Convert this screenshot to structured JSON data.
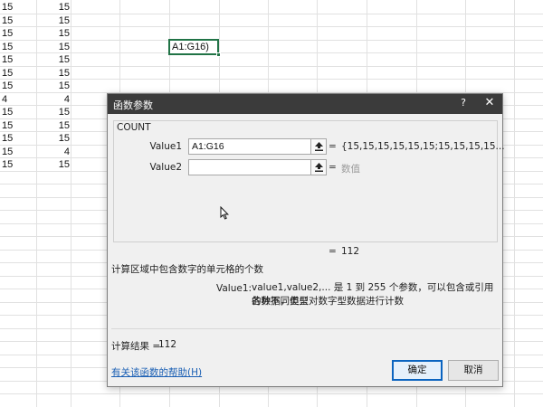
{
  "sheet": {
    "colA": [
      "15",
      "15",
      "15",
      "15",
      "15",
      "15",
      "15",
      "4",
      "15",
      "15",
      "15",
      "15",
      "15"
    ],
    "colB": [
      "15",
      "15",
      "15",
      "15",
      "15",
      "15",
      "15",
      "4",
      "15",
      "15",
      "15",
      "4",
      "15"
    ],
    "active_cell_text": "A1:G16)"
  },
  "dialog": {
    "title": "函数参数",
    "help_label": "?",
    "close_label": "✕",
    "function_name": "COUNT",
    "args": [
      {
        "label": "Value1",
        "value": "A1:G16",
        "placeholder": "",
        "equals": "=",
        "result": "{15,15,15,15,15,15;15,15,15,15..."
      },
      {
        "label": "Value2",
        "value": "",
        "placeholder": "",
        "equals": "=",
        "result": "数值"
      }
    ],
    "formula_result_equals": "=",
    "formula_result_value": "112",
    "description": "计算区域中包含数字的单元格的个数",
    "arg_desc_label": "Value1:",
    "arg_desc_line1": "value1,value2,... 是 1 到 255 个参数，可以包含或引用各种不同类型",
    "arg_desc_line2": "的数据，但只对数字型数据进行计数",
    "calc_result_label": "计算结果 =",
    "calc_result_value": "112",
    "help_link": "有关该函数的帮助(H)",
    "ok_label": "确定",
    "cancel_label": "取消",
    "icons": {
      "collapse": "collapse-dialog-icon",
      "cursor": "mouse-cursor-icon"
    }
  }
}
